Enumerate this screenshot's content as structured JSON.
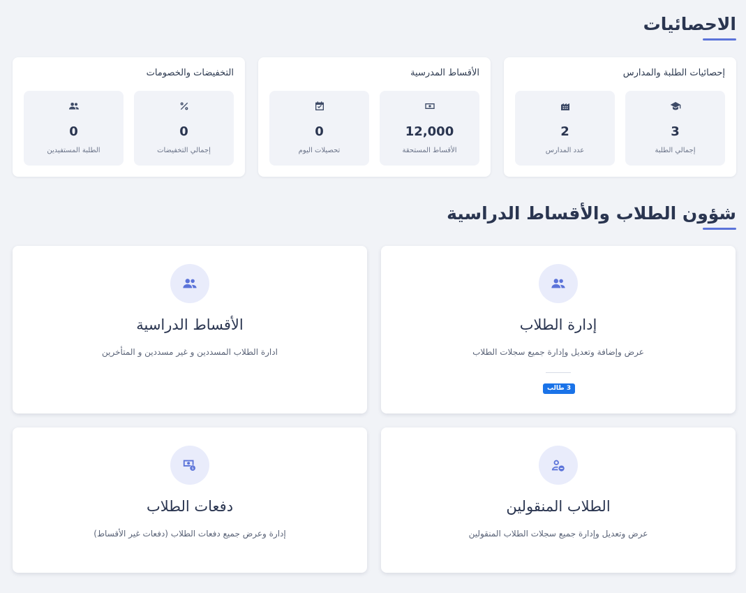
{
  "stats": {
    "title": "الاحصائيات",
    "groups": [
      {
        "title": "إحصائيات الطلبة والمدارس",
        "items": [
          {
            "icon": "graduation-cap-icon",
            "value": "3",
            "label": "إجمالي الطلبة"
          },
          {
            "icon": "building-icon",
            "value": "2",
            "label": "عدد المدارس"
          }
        ]
      },
      {
        "title": "الأقساط المدرسية",
        "items": [
          {
            "icon": "money-bill-icon",
            "value": "12,000",
            "label": "الأقساط المستحقة"
          },
          {
            "icon": "calendar-check-icon",
            "value": "0",
            "label": "تحصيلات اليوم"
          }
        ]
      },
      {
        "title": "التخفيضات والخصومات",
        "items": [
          {
            "icon": "percent-icon",
            "value": "0",
            "label": "إجمالي التخفيضات"
          },
          {
            "icon": "users-icon",
            "value": "0",
            "label": "الطلبة المستفيدين"
          }
        ]
      }
    ]
  },
  "affairs": {
    "title": "شؤون الطلاب والأقساط الدراسية",
    "cards": [
      {
        "icon": "users-icon",
        "title": "إدارة الطلاب",
        "desc": "عرض وإضافة وتعديل وإدارة جميع سجلات الطلاب",
        "badge": "3 طالب"
      },
      {
        "icon": "users-icon",
        "title": "الأقساط الدراسية",
        "desc": "ادارة الطلاب المسددين و غير مسددين و المتأخرين"
      },
      {
        "icon": "user-minus-icon",
        "title": "الطلاب المنقولين",
        "desc": "عرض وتعديل وإدارة جميع سجلات الطلاب المنقولين"
      },
      {
        "icon": "money-exchange-icon",
        "title": "دفعات الطلاب",
        "desc": "إدارة وعرض جميع دفعات الطلاب (دفعات غير الأقساط)"
      }
    ]
  },
  "colors": {
    "accent": "#5b73d9",
    "badge": "#1a73e8",
    "background": "#f1f3f7"
  }
}
